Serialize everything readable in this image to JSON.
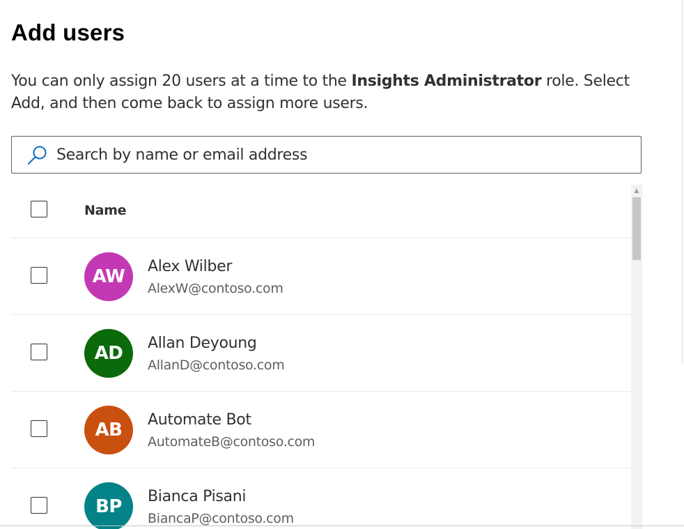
{
  "panel": {
    "title": "Add users",
    "description": {
      "part1": "You can only assign 20 users at a time to the ",
      "role": "Insights Administrator",
      "part2": " role. Select Add, and then come back to assign more users."
    }
  },
  "search": {
    "placeholder": "Search by name or email address",
    "value": "",
    "icon": "search-icon"
  },
  "table": {
    "header": {
      "name_label": "Name"
    },
    "users": [
      {
        "initials": "AW",
        "name": "Alex Wilber",
        "email": "AlexW@contoso.com",
        "color": "#c239b3"
      },
      {
        "initials": "AD",
        "name": "Allan Deyoung",
        "email": "AllanD@contoso.com",
        "color": "#0b6a0b"
      },
      {
        "initials": "AB",
        "name": "Automate Bot",
        "email": "AutomateB@contoso.com",
        "color": "#ca5010"
      },
      {
        "initials": "BP",
        "name": "Bianca Pisani",
        "email": "BiancaP@contoso.com",
        "color": "#038387"
      }
    ]
  }
}
